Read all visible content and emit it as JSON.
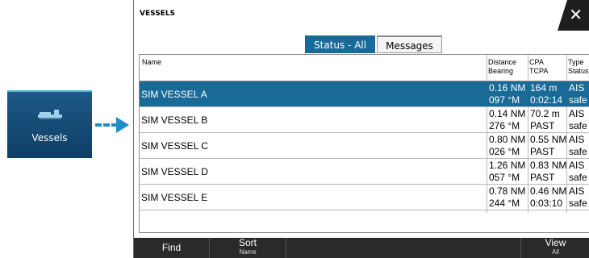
{
  "tile": {
    "label": "Vessels",
    "icon": "ship-icon"
  },
  "dialog": {
    "title": "VESSELS",
    "close_icon": "close-icon",
    "tabs": [
      {
        "label": "Status - All",
        "active": true
      },
      {
        "label": "Messages",
        "active": false
      }
    ],
    "columns": {
      "name": "Name",
      "distance_bearing": [
        "Distance",
        "Bearing"
      ],
      "cpa_tcpa": [
        "CPA",
        "TCPA"
      ],
      "type_status": [
        "Type",
        "Status"
      ]
    },
    "rows": [
      {
        "name": "SIM VESSEL A",
        "distance": "0.16 NM",
        "bearing": "097 °M",
        "cpa": "164 m",
        "tcpa": "0:02:14",
        "type": "AIS",
        "status": "safe",
        "selected": true
      },
      {
        "name": "SIM VESSEL B",
        "distance": "0.14 NM",
        "bearing": "276 °M",
        "cpa": "70.2 m",
        "tcpa": "PAST",
        "type": "AIS",
        "status": "safe",
        "selected": false
      },
      {
        "name": "SIM VESSEL C",
        "distance": "0.80 NM",
        "bearing": "026 °M",
        "cpa": "0.55 NM",
        "tcpa": "PAST",
        "type": "AIS",
        "status": "safe",
        "selected": false
      },
      {
        "name": "SIM VESSEL D",
        "distance": "1.26 NM",
        "bearing": "057 °M",
        "cpa": "0.83 NM",
        "tcpa": "PAST",
        "type": "AIS",
        "status": "safe",
        "selected": false
      },
      {
        "name": "SIM VESSEL E",
        "distance": "0.78 NM",
        "bearing": "244 °M",
        "cpa": "0.46 NM",
        "tcpa": "0:03:10",
        "type": "AIS",
        "status": "safe",
        "selected": false
      }
    ],
    "footer": {
      "find": "Find",
      "sort": "Sort",
      "sort_value": "Name",
      "view": "View",
      "view_value": "All"
    }
  },
  "colors": {
    "accent": "#1a6a98",
    "footer": "#2a2a2a"
  }
}
